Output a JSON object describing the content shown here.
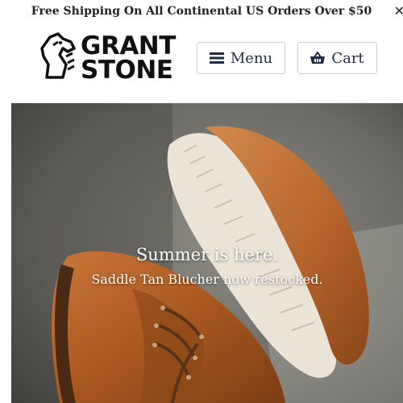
{
  "announcement": {
    "text": "Free Shipping On All Continental US Orders Over $50",
    "close_icon": "close-icon",
    "close_glyph": "✕"
  },
  "header": {
    "logo": {
      "line1": "GRANT",
      "line2": "STONE",
      "icon": "horse-head-logo"
    },
    "menu_label": "Menu",
    "menu_icon": "hamburger-icon",
    "cart_label": "Cart",
    "cart_icon": "basket-icon"
  },
  "hero": {
    "title": "Summer is here.",
    "subtitle": "Saddle Tan Blucher now restocked.",
    "image": "saddle-tan-blucher-shoes-photo"
  },
  "colors": {
    "text": "#222222",
    "button_text": "#1f2a44",
    "button_border": "#cfcfcf",
    "leather": "#b8652a",
    "sole": "#ece6da"
  }
}
